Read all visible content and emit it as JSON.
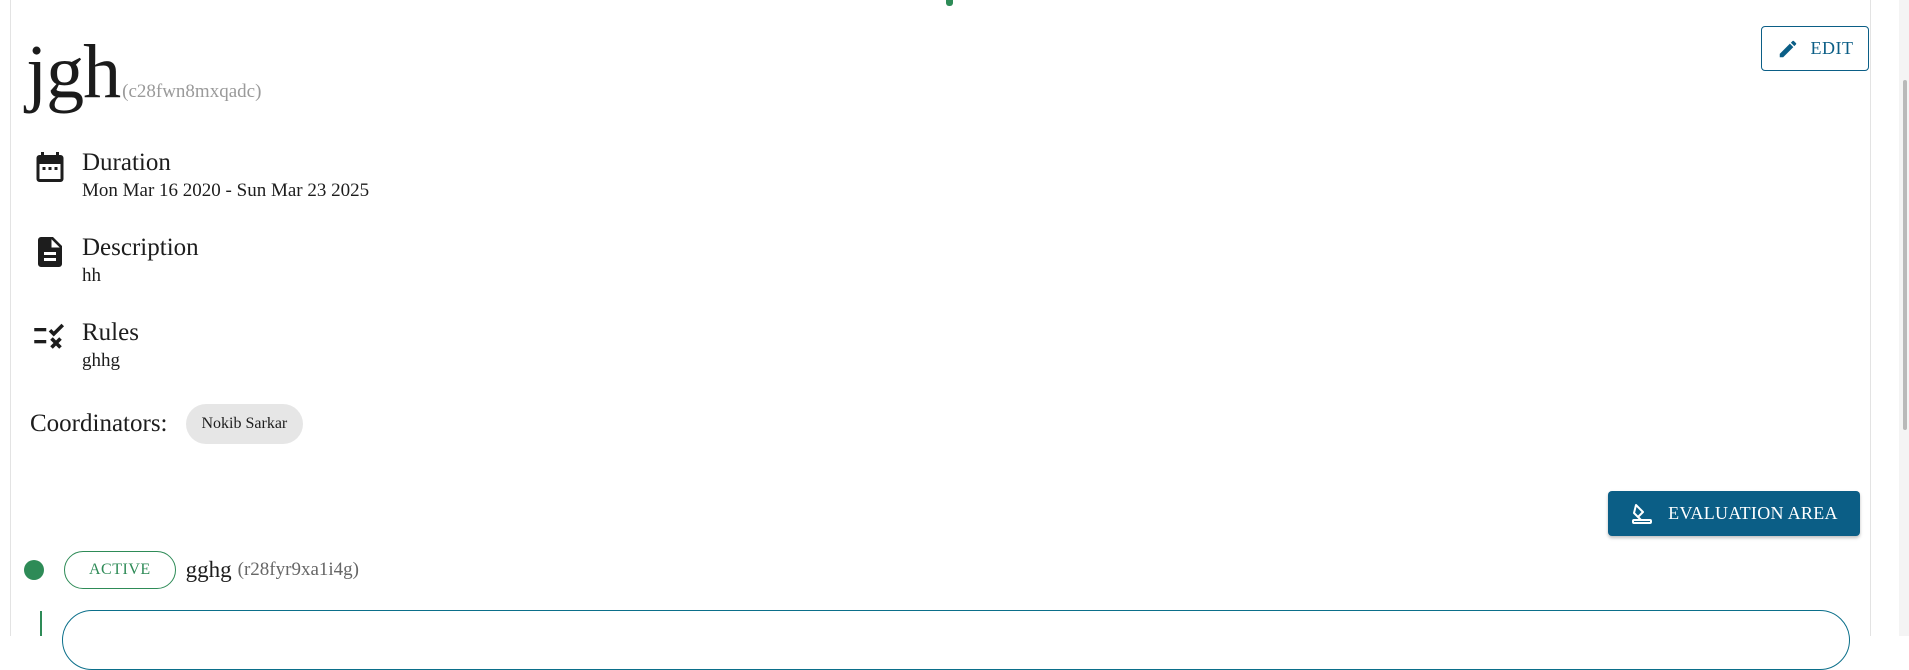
{
  "title": "jgh",
  "title_code": "(c28fwn8mxqadc)",
  "edit_button": {
    "label": "EDIT",
    "icon": "pencil-icon"
  },
  "duration": {
    "label": "Duration",
    "value": "Mon Mar 16 2020 - Sun Mar 23 2025",
    "icon": "calendar-icon"
  },
  "description": {
    "label": "Description",
    "value": "hh",
    "icon": "document-icon"
  },
  "rules": {
    "label": "Rules",
    "value": "ghhg",
    "icon": "rules-checklist-icon"
  },
  "coordinators": {
    "label": "Coordinators:",
    "items": [
      "Nokib Sarkar"
    ]
  },
  "evaluation_button": {
    "label": "EVALUATION AREA",
    "icon": "evaluation-icon"
  },
  "round": {
    "status": "ACTIVE",
    "title": "gghg",
    "code": "(r28fyr9xa1i4g)"
  },
  "colors": {
    "primary": "#0b5e86",
    "active": "#2e8b57",
    "chip_bg": "#e6e6e6"
  }
}
